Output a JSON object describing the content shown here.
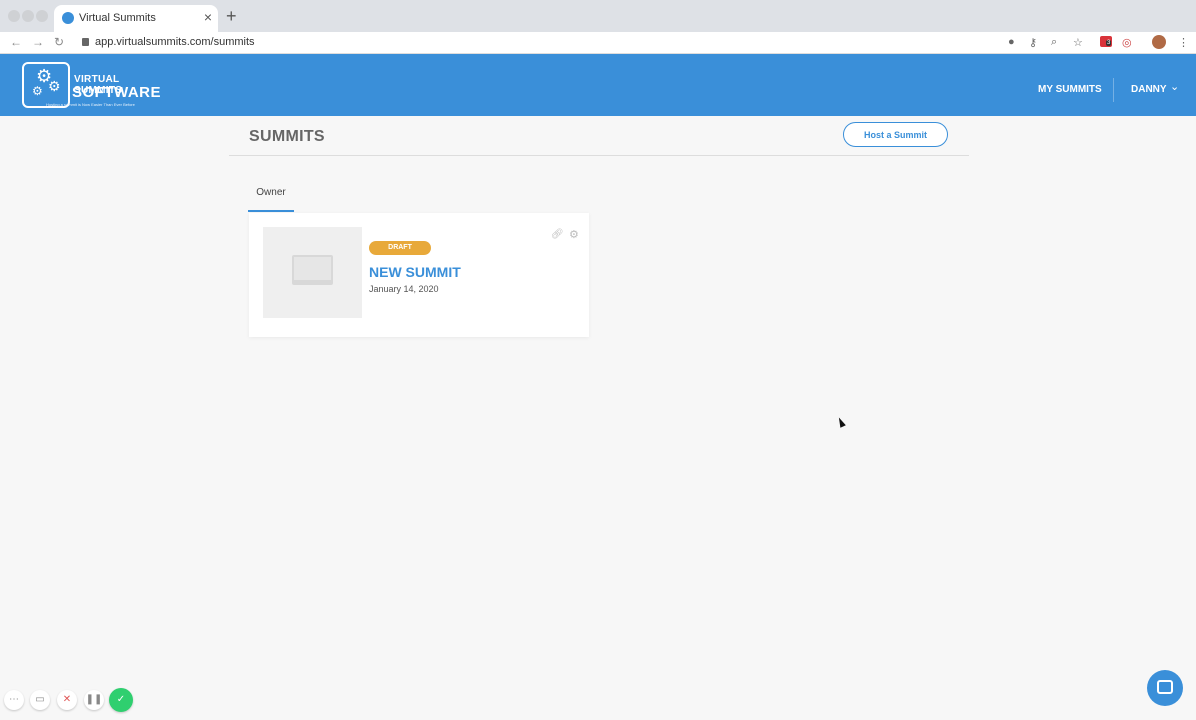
{
  "browser": {
    "tab_title": "Virtual Summits",
    "tab_close": "×",
    "new_tab": "+",
    "url": "app.virtualsummits.com/summits",
    "back": "←",
    "forward": "→",
    "reload": "↻",
    "extension_badge": "3"
  },
  "header": {
    "logo_line1": "VIRTUAL SUMMITS",
    "logo_line2": "SOFTWARE",
    "logo_tagline": "Hosting a summit is Now Easier Than Ever Before",
    "nav_my_summits": "MY SUMMITS",
    "nav_user": "DANNY"
  },
  "page": {
    "title": "SUMMITS",
    "host_button": "Host a Summit",
    "tab_owner": "Owner"
  },
  "summits": [
    {
      "status": "DRAFT",
      "title": "NEW SUMMIT",
      "date": "January 14, 2020"
    }
  ],
  "colors": {
    "brand_blue": "#3a8fd9",
    "draft_badge": "#e8a93a",
    "success_green": "#2fcf6f"
  }
}
